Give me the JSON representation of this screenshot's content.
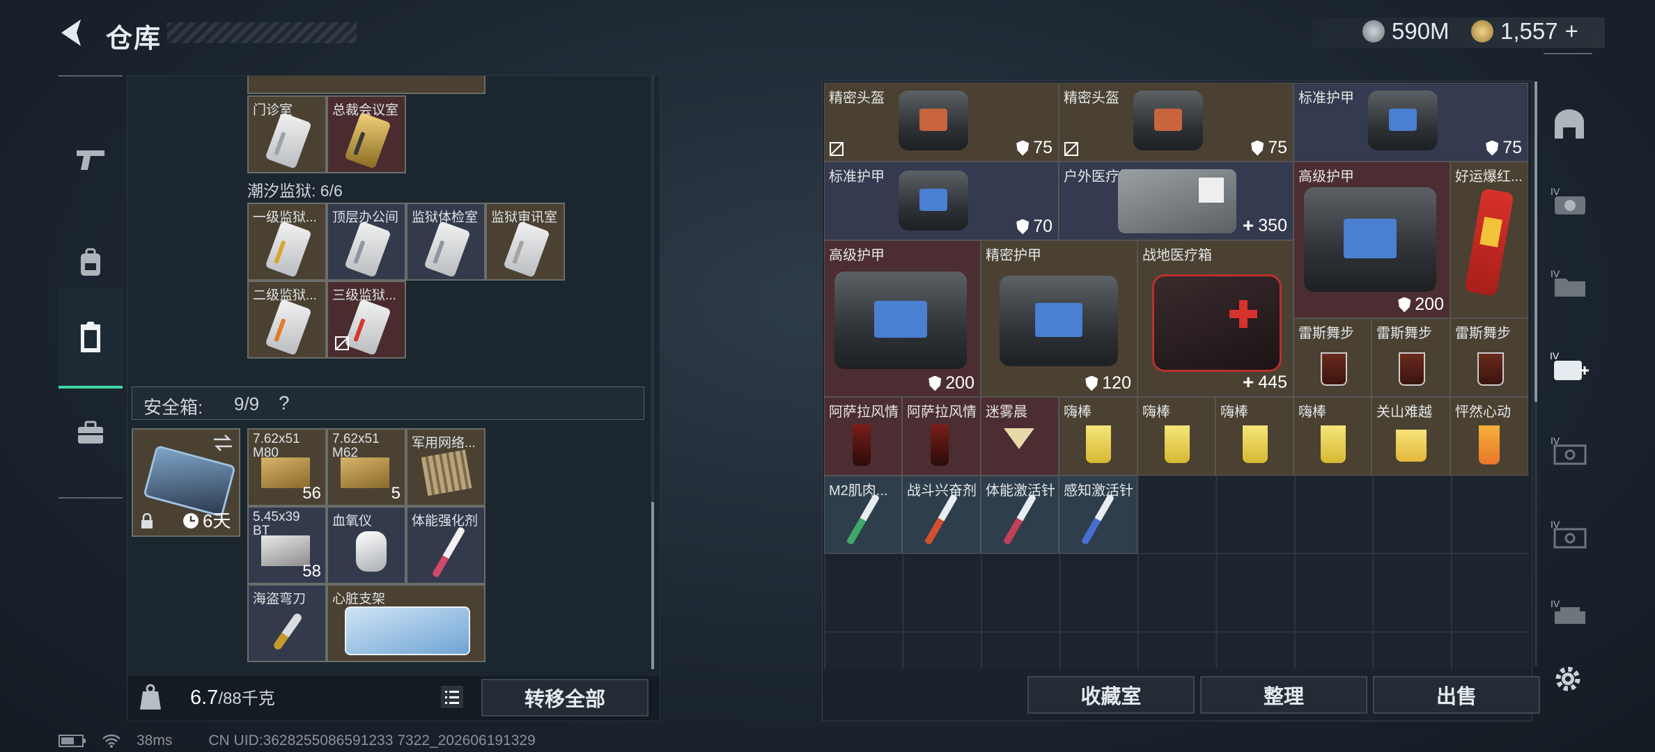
{
  "header": {
    "title": "仓库"
  },
  "currency": {
    "money": "590M",
    "tokens": "1,557",
    "add_symbol": "+"
  },
  "left_panel": {
    "top_cards": [
      {
        "label": "门诊室",
        "color": "brown",
        "stripe": "#9aa3aa"
      },
      {
        "label": "总裁会议室",
        "color": "red",
        "stripe": "#c8a24a"
      }
    ],
    "prison_section": "潮汐监狱: 6/6",
    "prison_cards": [
      {
        "label": "一级监狱...",
        "color": "brown",
        "stripe": "#d7a52e"
      },
      {
        "label": "顶层办公间",
        "color": "blue",
        "stripe": "#8e95a2"
      },
      {
        "label": "监狱体检室",
        "color": "blue",
        "stripe": "#8e95a2"
      },
      {
        "label": "监狱审讯室",
        "color": "brown",
        "stripe": "#a8a2a0"
      },
      {
        "label": "二级监狱...",
        "color": "brown",
        "stripe": "#e07a2a"
      },
      {
        "label": "三级监狱...",
        "color": "red",
        "stripe": "#d4382e"
      }
    ],
    "safebox": {
      "title": "安全箱:",
      "count": "9/9",
      "help": "?",
      "timer": "6天"
    },
    "safebox_items": [
      {
        "label": "7.62x51 M80",
        "count": "56",
        "color": "brown"
      },
      {
        "label": "7.62x51 M62",
        "count": "5",
        "color": "brown"
      },
      {
        "label": "军用网络...",
        "count": "",
        "color": "brown"
      },
      {
        "label": "5.45x39 BT",
        "count": "58",
        "color": "blue"
      },
      {
        "label": "血氧仪",
        "count": "",
        "color": "blue"
      },
      {
        "label": "体能强化剂",
        "count": "",
        "color": "blue"
      },
      {
        "label": "海盗弯刀",
        "count": "",
        "color": "blue"
      },
      {
        "label": "心脏支架",
        "count": "",
        "color": "brown"
      }
    ],
    "weight": {
      "current": "6.7",
      "max": "/88千克"
    },
    "transfer_all": "转移全部"
  },
  "right_panel": {
    "items": [
      {
        "label": "精密头盔",
        "stat": "75",
        "stat_type": "shield",
        "color": "brown"
      },
      {
        "label": "精密头盔",
        "stat": "75",
        "stat_type": "shield",
        "color": "brown"
      },
      {
        "label": "标准护甲",
        "stat": "75",
        "stat_type": "shield",
        "color": "blue"
      },
      {
        "label": "标准护甲",
        "stat": "70",
        "stat_type": "shield",
        "color": "blue"
      },
      {
        "label": "户外医疗箱",
        "stat": "350",
        "stat_type": "plus",
        "color": "blue"
      },
      {
        "label": "高级护甲",
        "stat": "200",
        "stat_type": "shield",
        "color": "red"
      },
      {
        "label": "好运爆红...",
        "stat": "",
        "stat_type": "",
        "color": "brown"
      },
      {
        "label": "高级护甲",
        "stat": "200",
        "stat_type": "shield",
        "color": "red"
      },
      {
        "label": "精密护甲",
        "stat": "120",
        "stat_type": "shield",
        "color": "brown"
      },
      {
        "label": "战地医疗箱",
        "stat": "445",
        "stat_type": "plus",
        "color": "brown"
      },
      {
        "label": "雷斯舞步",
        "color": "brown"
      },
      {
        "label": "雷斯舞步",
        "color": "brown"
      },
      {
        "label": "雷斯舞步",
        "color": "brown"
      },
      {
        "label": "阿萨拉风情",
        "color": "red"
      },
      {
        "label": "阿萨拉风情",
        "color": "red"
      },
      {
        "label": "迷雾晨",
        "color": "red"
      },
      {
        "label": "嗨棒",
        "color": "brown"
      },
      {
        "label": "嗨棒",
        "color": "brown"
      },
      {
        "label": "嗨棒",
        "color": "brown"
      },
      {
        "label": "嗨棒",
        "color": "brown"
      },
      {
        "label": "关山难越",
        "color": "brown"
      },
      {
        "label": "怦然心动",
        "color": "brown"
      },
      {
        "label": "M2肌肉...",
        "color": "steel"
      },
      {
        "label": "战斗兴奋剂",
        "color": "steel"
      },
      {
        "label": "体能激活针",
        "color": "steel"
      },
      {
        "label": "感知激活针",
        "color": "steel"
      }
    ],
    "buttons": {
      "collection": "收藏室",
      "organize": "整理",
      "sell": "出售"
    }
  },
  "status": {
    "ping": "38ms",
    "uid": "CN UID:3628255086591233 7322_202606191329"
  },
  "icons": {
    "sidenav": [
      "gun-icon",
      "backpack-icon",
      "armor-vest-icon",
      "toolbox-icon"
    ],
    "rail": [
      "helmet-icon",
      "iv-camera-icon",
      "iv-folder-icon",
      "iv-medkit-icon",
      "iv-safe-icon",
      "iv-safe-2-icon",
      "iv-printer-icon",
      "gear-icon"
    ]
  },
  "colors": {
    "accent": "#3fd6a4"
  }
}
